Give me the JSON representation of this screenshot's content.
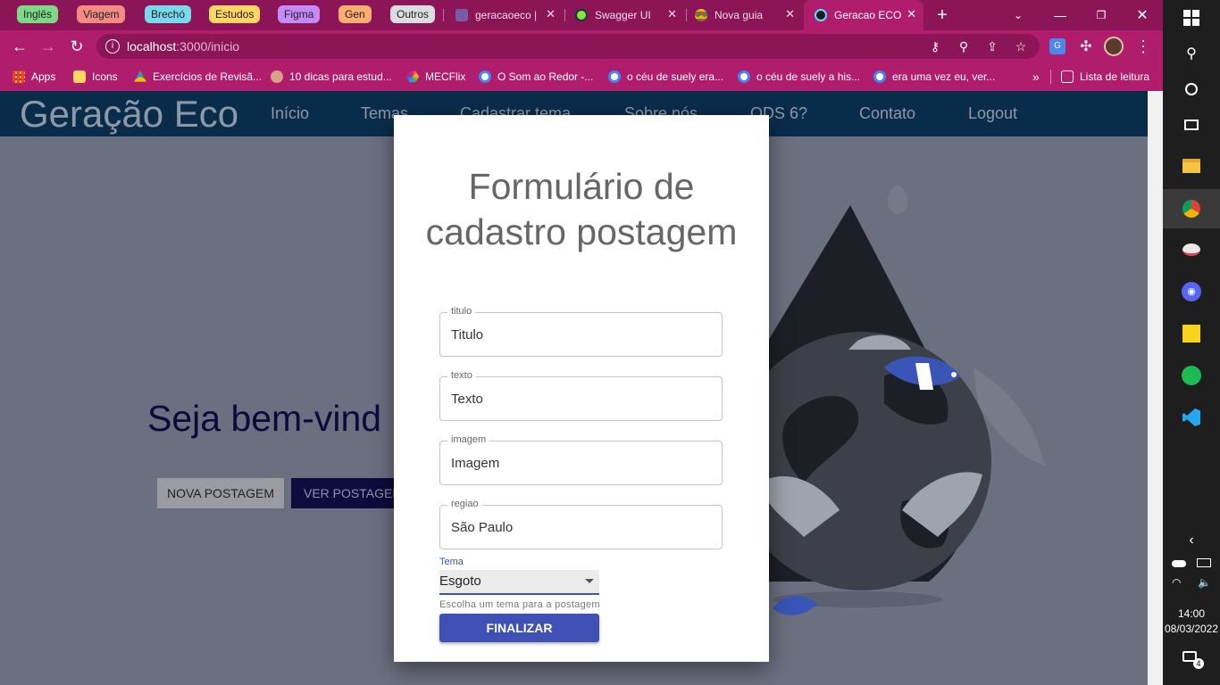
{
  "browser": {
    "tab_groups": [
      {
        "label": "Inglês",
        "color": "#7ed987"
      },
      {
        "label": "Viagem",
        "color": "#f28b82"
      },
      {
        "label": "Brechó",
        "color": "#78d9ec"
      },
      {
        "label": "Estudos",
        "color": "#fdd663"
      },
      {
        "label": "Figma",
        "color": "#c58af9"
      },
      {
        "label": "Gen",
        "color": "#fcad70"
      },
      {
        "label": "Outros",
        "color": "#dadce0"
      }
    ],
    "tabs": [
      {
        "title": "geracaoeco |",
        "icon": "heroku-icon"
      },
      {
        "title": "Swagger UI",
        "icon": "swagger-icon"
      },
      {
        "title": "Nova guia",
        "icon": "chrome-icon"
      },
      {
        "title": "Geracao ECO",
        "icon": "react-icon",
        "active": true
      }
    ],
    "url_host": "localhost",
    "url_path": ":3000/inicio",
    "bookmarks": [
      {
        "label": "Apps",
        "icon": "apps-grid-icon",
        "color": "#e8453c"
      },
      {
        "label": "Icons",
        "icon": "folder-icon",
        "color": "#fdd663"
      },
      {
        "label": "Exercícios de Revisã...",
        "icon": "drive-icon",
        "color": "#34a853"
      },
      {
        "label": "10 dicas para estud...",
        "icon": "avatar-icon",
        "color": "#d9a38a"
      },
      {
        "label": "MECFlix",
        "icon": "mecflix-icon",
        "color": "#9c27b0"
      },
      {
        "label": "O Som ao Redor -...",
        "icon": "google-icon",
        "color": "#ffffff"
      },
      {
        "label": "o céu de suely era...",
        "icon": "google-icon",
        "color": "#ffffff"
      },
      {
        "label": "o céu de suely a his...",
        "icon": "google-icon",
        "color": "#ffffff"
      },
      {
        "label": "era uma vez eu, ver...",
        "icon": "google-icon",
        "color": "#ffffff"
      }
    ],
    "overflow": "»",
    "reading_list": "Lista de leitura"
  },
  "site": {
    "brand": "Geração Eco",
    "nav": [
      "Início",
      "Temas",
      "Cadastrar tema",
      "Sobre nós",
      "ODS 6?",
      "Contato",
      "Logout"
    ],
    "welcome": "Seja bem-vind",
    "btn_nova": "NOVA POSTAGEM",
    "btn_ver": "VER POSTAGENS"
  },
  "form": {
    "title": "Formulário de cadastro postagem",
    "fields": [
      {
        "label": "titulo",
        "value": "Titulo"
      },
      {
        "label": "texto",
        "value": "Texto"
      },
      {
        "label": "imagem",
        "value": "Imagem"
      },
      {
        "label": "regiao",
        "value": "São Paulo"
      }
    ],
    "tema_label": "Tema",
    "tema_value": "Esgoto",
    "tema_help": "Escolha um tema para a postagem",
    "submit": "FINALIZAR"
  },
  "taskbar": {
    "time": "14:00",
    "date": "08/03/2022",
    "notifications": "4"
  }
}
